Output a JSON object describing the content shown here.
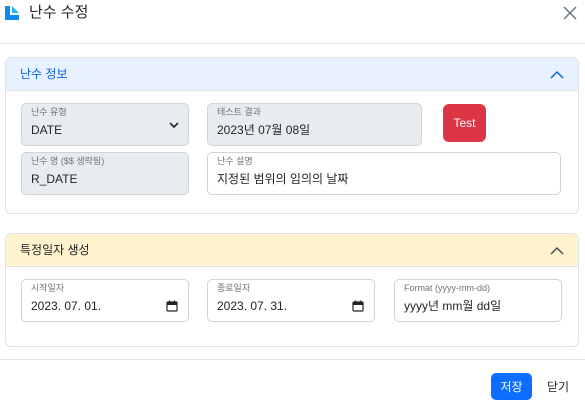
{
  "modal": {
    "title": "난수 수정"
  },
  "info_section": {
    "title": "난수 정보",
    "random_type": {
      "label": "난수 유형",
      "value": "DATE"
    },
    "test_result": {
      "label": "테스트 결과",
      "value": "2023년 07월 08일"
    },
    "test_button": "Test",
    "random_name": {
      "label": "난수 명 ($$ 생략됨)",
      "value": "R_DATE"
    },
    "description": {
      "label": "난수 설명",
      "value": "지정된 범위의 임의의 날짜"
    }
  },
  "date_section": {
    "title": "특정일자 생성",
    "start_date": {
      "label": "시작일자",
      "value": "2023. 07. 01."
    },
    "end_date": {
      "label": "종료일자",
      "value": "2023. 07. 31."
    },
    "format": {
      "label": "Format (yyyy-mm-dd)",
      "value": "yyyy년 mm월 dd일"
    }
  },
  "footer": {
    "save": "저장",
    "close": "닫기"
  },
  "colors": {
    "primary": "#0d6efd",
    "danger": "#dc3545",
    "info_header": "#e7f1ff",
    "date_header": "#fff3cd"
  },
  "icons": {
    "logo": "app-logo-icon",
    "close": "close-icon",
    "collapse": "chevron-up-icon",
    "dropdown": "chevron-down-icon",
    "calendar": "calendar-icon"
  }
}
